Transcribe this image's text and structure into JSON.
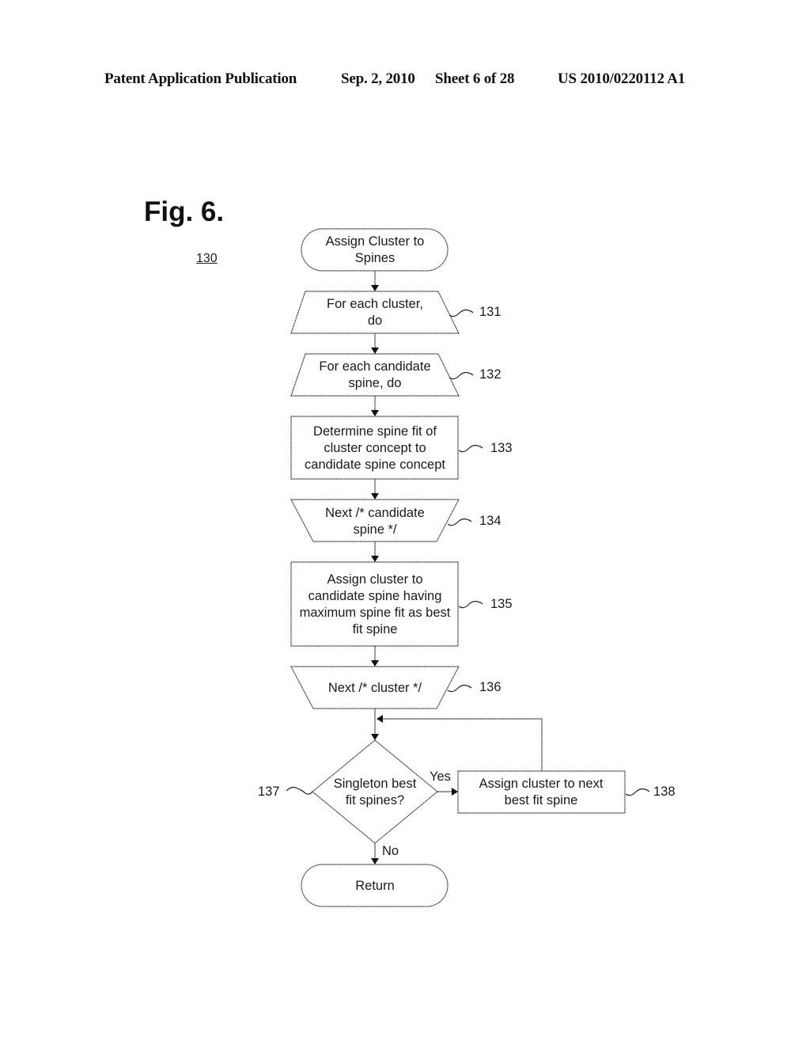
{
  "header": {
    "publication": "Patent Application Publication",
    "date": "Sep. 2, 2010",
    "sheet": "Sheet 6 of 28",
    "number": "US 2010/0220112 A1"
  },
  "figure": {
    "title": "Fig. 6.",
    "reference": "130"
  },
  "nodes": [
    {
      "id": "start",
      "type": "terminator",
      "lines": [
        "Assign Cluster to",
        "Spines"
      ],
      "ref": ""
    },
    {
      "id": "loop-cluster",
      "type": "loop-start",
      "lines": [
        "For each cluster,",
        "do"
      ],
      "ref": "131"
    },
    {
      "id": "loop-spine",
      "type": "loop-start",
      "lines": [
        "For each candidate",
        "spine, do"
      ],
      "ref": "132"
    },
    {
      "id": "determine-fit",
      "type": "process",
      "lines": [
        "Determine spine fit of",
        "cluster concept to",
        "candidate spine concept"
      ],
      "ref": "133"
    },
    {
      "id": "next-spine",
      "type": "loop-end",
      "lines": [
        "Next /* candidate",
        "spine */"
      ],
      "ref": "134"
    },
    {
      "id": "assign-best",
      "type": "process",
      "lines": [
        "Assign cluster to",
        "candidate spine having",
        "maximum spine fit as best",
        "fit spine"
      ],
      "ref": "135"
    },
    {
      "id": "next-cluster",
      "type": "loop-end",
      "lines": [
        "Next /* cluster */"
      ],
      "ref": "136"
    },
    {
      "id": "decision",
      "type": "decision",
      "lines": [
        "Singleton best",
        "fit spines?"
      ],
      "ref": "137"
    },
    {
      "id": "assign-next",
      "type": "process",
      "lines": [
        "Assign cluster to next",
        "best fit spine"
      ],
      "ref": "138"
    },
    {
      "id": "return",
      "type": "terminator",
      "lines": [
        "Return"
      ],
      "ref": ""
    }
  ],
  "edges": {
    "yes_label": "Yes",
    "no_label": "No"
  }
}
